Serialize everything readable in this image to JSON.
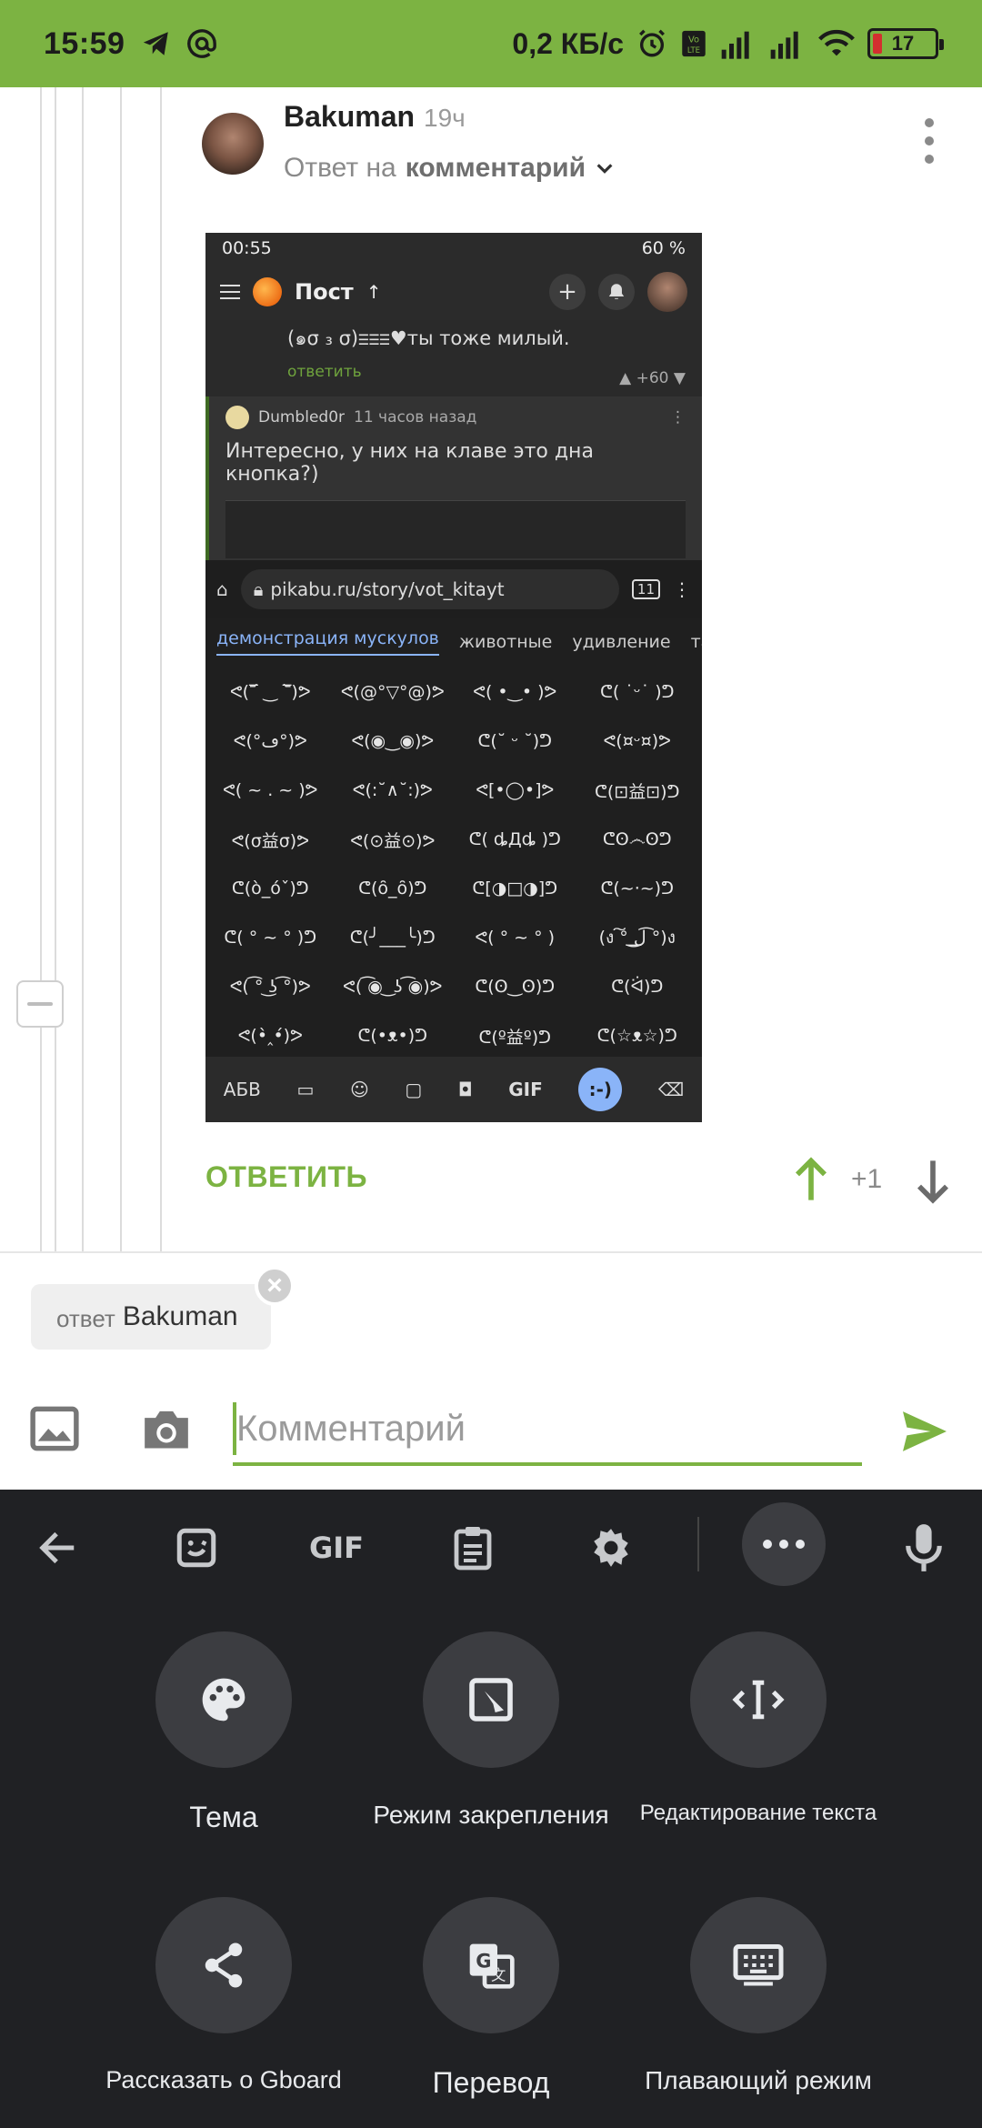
{
  "status_bar": {
    "time": "15:59",
    "speed": "0,2 КБ/с",
    "battery": "17"
  },
  "comment": {
    "author": "Bakuman",
    "time": "19ч",
    "reply_prefix": "Ответ на",
    "reply_target": "комментарий",
    "reply_button": "ОТВЕТИТЬ",
    "vote_count": "+1"
  },
  "embedded": {
    "status_time": "00:55",
    "status_right": "60 %",
    "app_title": "Пост",
    "comment1_text": "(๑σ ₃ σ)ⲷⲷⲷ♥ты тоже милый.",
    "comment1_link": "ответить",
    "comment1_votes": "+60",
    "comment2_author": "Dumbled0r",
    "comment2_time": "11 часов назад",
    "comment2_text": "Интересно, у них на клаве это дна кнопка?)",
    "url": "pikabu.ru/story/vot_kitayt",
    "tabs_count": "11",
    "tabs": [
      "демонстрация мускулов",
      "животные",
      "удивление",
      "та"
    ],
    "kaomoji": [
      "ᕙ(‾᷄ ‿ ‾᷅)ᕗ",
      "ᕙ(@°▽°@)ᕗ",
      "ᕙ( •‿• )ᕗ",
      "ᕦ( ˙ᵕ˙ )ᕤ",
      "ᕙ(°ڡ°)ᕗ",
      "ᕙ(◉‿◉)ᕗ",
      "ᕦ(˘ ᵕ ˘)ᕤ",
      "ᕙ(¤ᵕ¤)ᕗ",
      "ᕙ( ~ . ~ )ᕗ",
      "ᕙ(:˘∧˘:)ᕗ",
      "ᕙ[•◯•]ᕗ",
      "ᕦ(⊡益⊡)ᕤ",
      "ᕙ(σ益σ)ᕗ",
      "ᕙ(⊙益⊙)ᕗ",
      "ᕦ( ȡДȡ )ᕤ",
      "ᕦʘ෴ʘᕤ",
      "ᕦ(ò_óˇ)ᕤ",
      "ᕦ(ȏ_ȏ)ᕤ",
      "ᕦ[◑□◑]ᕤ",
      "ᕦ(~·~)ᕤ",
      "ᕦ( ° ~ ° )ᕤ",
      "ᕦ(╯___╰)ᕤ",
      "ᕙ( ° ~ ° )",
      "(ง ͠° ͟ل͜ ͡°)ง",
      "ᕙ( ͡° ͜ʖ ͡°)ᕗ",
      "ᕙ( ͡◉ ͜ ʖ ͡◉)ᕗ",
      "ᕦ(ʘ‿ʘ)ᕤ",
      "ᕦ(ᐛ)ᕤ",
      "ᕙ(•̀‸•́)ᕗ",
      "ᕦ(•ᴥ•)ᕤ",
      "ᕦ(º益º)ᕤ",
      "ᕦ(☆ᴥ☆)ᕤ"
    ],
    "kb_abc": "АБВ",
    "kb_gif": "GIF",
    "kb_emoticon": ":-)"
  },
  "composer": {
    "chip_prefix": "ответ",
    "chip_name": "Bakuman",
    "placeholder": "Комментарий"
  },
  "keyboard": {
    "items": [
      {
        "label": "Тема",
        "icon": "palette-icon"
      },
      {
        "label": "Режим закрепления",
        "icon": "dock-mode-icon"
      },
      {
        "label": "Редактирование текста",
        "icon": "text-editing-icon"
      },
      {
        "label": "Рассказать о Gboard",
        "icon": "share-icon"
      },
      {
        "label": "Перевод",
        "icon": "translate-icon"
      },
      {
        "label": "Плавающий режим",
        "icon": "floating-keyboard-icon"
      }
    ],
    "gif_label": "GIF"
  }
}
